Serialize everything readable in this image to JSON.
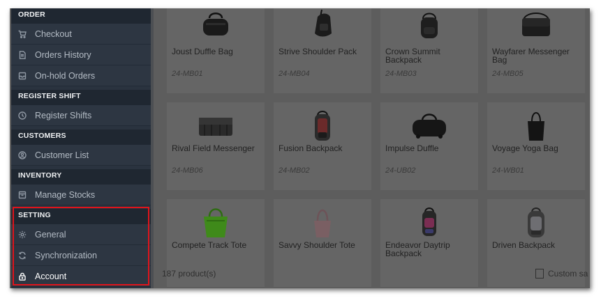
{
  "sidebar": {
    "sections": [
      {
        "header": "ORDER",
        "items": [
          {
            "label": "Checkout",
            "icon": "cart-icon"
          },
          {
            "label": "Orders History",
            "icon": "document-icon"
          },
          {
            "label": "On-hold Orders",
            "icon": "tray-icon"
          }
        ]
      },
      {
        "header": "REGISTER SHIFT",
        "items": [
          {
            "label": "Register Shifts",
            "icon": "clock-icon"
          }
        ]
      },
      {
        "header": "CUSTOMERS",
        "items": [
          {
            "label": "Customer List",
            "icon": "user-circle-icon"
          }
        ]
      },
      {
        "header": "INVENTORY",
        "items": [
          {
            "label": "Manage Stocks",
            "icon": "box-icon"
          }
        ]
      },
      {
        "header": "SETTING",
        "items": [
          {
            "label": "General",
            "icon": "gear-icon"
          },
          {
            "label": "Synchronization",
            "icon": "sync-icon"
          },
          {
            "label": "Account",
            "icon": "lock-icon",
            "active": true
          }
        ]
      }
    ]
  },
  "products": [
    {
      "name": "Joust Duffle Bag",
      "sku": "24-MB01",
      "icon": "duffle-bag-icon"
    },
    {
      "name": "Strive Shoulder Pack",
      "sku": "24-MB04",
      "icon": "shoulder-pack-icon"
    },
    {
      "name": "Crown Summit Backpack",
      "sku": "24-MB03",
      "icon": "backpack-icon"
    },
    {
      "name": "Wayfarer Messenger Bag",
      "sku": "24-MB05",
      "icon": "messenger-bag-icon"
    },
    {
      "name": "Rival Field Messenger",
      "sku": "24-MB06",
      "icon": "messenger-bag-icon"
    },
    {
      "name": "Fusion Backpack",
      "sku": "24-MB02",
      "icon": "backpack-icon"
    },
    {
      "name": "Impulse Duffle",
      "sku": "24-UB02",
      "icon": "duffle-bag-icon"
    },
    {
      "name": "Voyage Yoga Bag",
      "sku": "24-WB01",
      "icon": "tote-bag-icon"
    },
    {
      "name": "Compete Track Tote",
      "sku": "",
      "icon": "tote-bag-icon"
    },
    {
      "name": "Savvy Shoulder Tote",
      "sku": "",
      "icon": "shoulder-tote-icon"
    },
    {
      "name": "Endeavor Daytrip Backpack",
      "sku": "",
      "icon": "backpack-icon"
    },
    {
      "name": "Driven Backpack",
      "sku": "",
      "icon": "backpack-icon"
    }
  ],
  "footer": {
    "product_count": "187 product(s)",
    "custom_label": "Custom sa"
  },
  "colors": {
    "highlight": "#e0141b",
    "sidebar_bg": "#2a333f",
    "section_header_bg": "#1f2731"
  }
}
